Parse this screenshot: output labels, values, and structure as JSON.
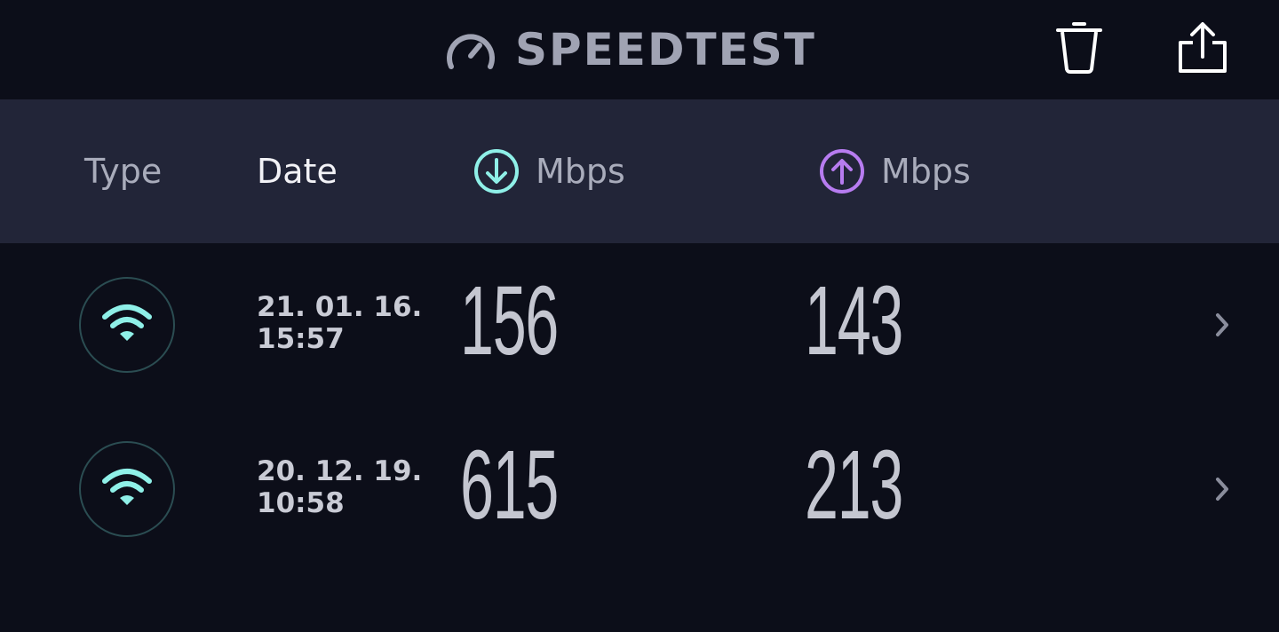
{
  "header": {
    "title": "SPEEDTEST",
    "logo_icon": "speedometer-icon",
    "actions": [
      {
        "name": "trash-icon"
      },
      {
        "name": "share-icon"
      }
    ]
  },
  "columns": {
    "type": "Type",
    "date": "Date",
    "download": "Mbps",
    "upload": "Mbps",
    "download_icon": "download-arrow-icon",
    "upload_icon": "upload-arrow-icon"
  },
  "results": [
    {
      "connection_icon": "wifi-icon",
      "date": "21. 01. 16.",
      "time": "15:57",
      "download": "156",
      "upload": "143"
    },
    {
      "connection_icon": "wifi-icon",
      "date": "20. 12. 19.",
      "time": "10:58",
      "download": "615",
      "upload": "213"
    }
  ],
  "colors": {
    "background": "#0c0e19",
    "header_bar": "#222538",
    "download_accent": "#8ff0e8",
    "upload_accent": "#b77cf0",
    "wifi": "#8ff0e8"
  }
}
